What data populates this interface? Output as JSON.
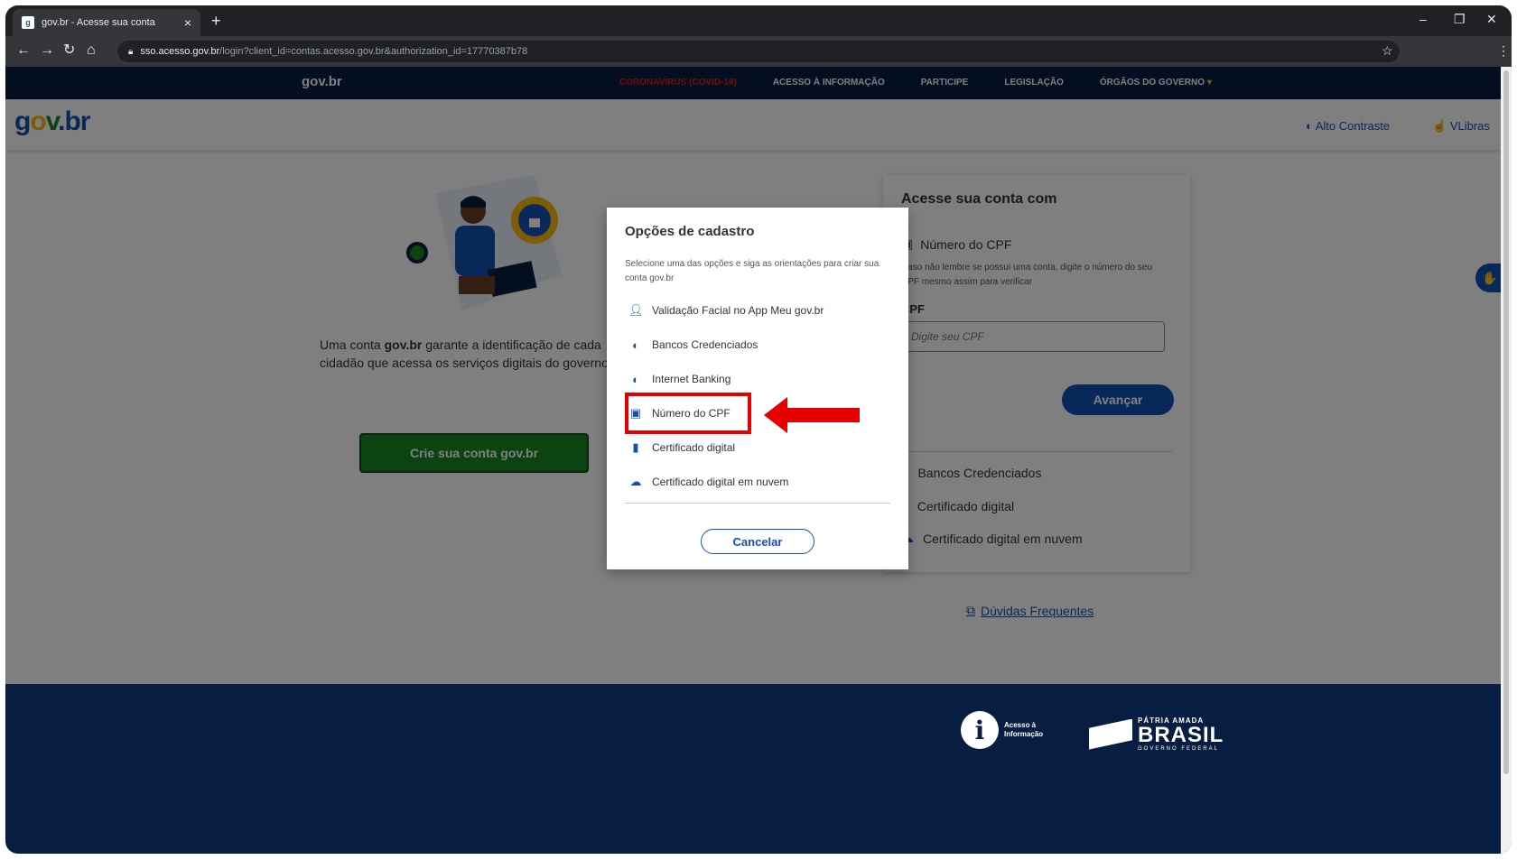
{
  "browser": {
    "tab_title": "gov.br - Acesse sua conta",
    "tab_favicon": "gov",
    "url_host": "sso.acesso.gov.br",
    "url_path": "/login?client_id=contas.acesso.gov.br&authorization_id=17770387b78"
  },
  "govbar": {
    "brand": "gov.br",
    "nav": [
      "CORONAVÍRUS (COVID-19)",
      "ACESSO À INFORMAÇÃO",
      "PARTICIPE",
      "LEGISLAÇÃO",
      "ÓRGÃOS DO GOVERNO"
    ]
  },
  "header": {
    "logo": {
      "g": "g",
      "o": "o",
      "v": "v",
      "dot": ".",
      "br": "br"
    },
    "contrast": "Alto Contraste",
    "vlibras": "VLibras"
  },
  "intro": {
    "text_prefix": "Uma conta ",
    "brand": "gov.br",
    "text_suffix": " garante a identificação de cada cidadão que acessa os serviços digitais do governo"
  },
  "cta": {
    "label": "Crie sua conta gov.br"
  },
  "panel": {
    "title": "Acesse sua conta com",
    "option_title": "Número do CPF",
    "help": "Caso não lembre se possui uma conta, digite o número do seu CPF mesmo assim para verificar",
    "field_label": "CPF",
    "field_placeholder": "Digite seu CPF",
    "submit": "Avançar",
    "alt_options": [
      "Bancos Credenciados",
      "Certificado digital",
      "Certificado digital em nuvem"
    ]
  },
  "faq": {
    "label": "Dúvidas Frequentes"
  },
  "modal": {
    "title": "Opções de cadastro",
    "description": "Selecione uma das opções e siga as orientações para criar sua conta gov.br",
    "options": [
      {
        "label": "Validação Facial no App Meu gov.br",
        "icon": "face-id-icon"
      },
      {
        "label": "Bancos Credenciados",
        "icon": "bank-icon"
      },
      {
        "label": "Internet Banking",
        "icon": "bank-icon"
      },
      {
        "label": "Número do CPF",
        "icon": "id-card-icon"
      },
      {
        "label": "Certificado digital",
        "icon": "usb-token-icon"
      },
      {
        "label": "Certificado digital em nuvem",
        "icon": "cloud-icon"
      }
    ],
    "cancel": "Cancelar"
  },
  "footer": {
    "acesso_line1": "Acesso à",
    "acesso_line2": "Informação",
    "brasil_top": "PÁTRIA AMADA",
    "brasil_main": "BRASIL",
    "brasil_bottom": "GOVERNO FEDERAL"
  },
  "colors": {
    "gov_blue": "#1351b4",
    "gov_navy": "#071d41",
    "gov_green": "#168821",
    "highlight_red": "#e60000"
  }
}
